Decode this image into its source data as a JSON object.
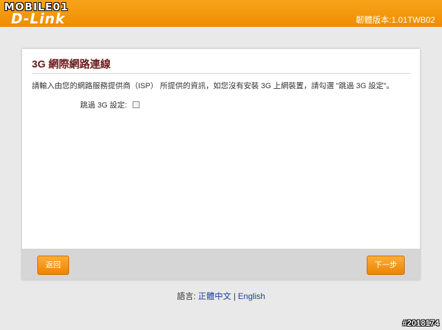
{
  "header": {
    "watermark_top": "MOBILE01",
    "logo_text": "D-Link",
    "firmware": "韌體版本:1.01TWB02"
  },
  "panel": {
    "title": "3G 網際網路連線",
    "description": "請輸入由您的網路服務提供商（ISP） 所提供的資訊，如您沒有安裝 3G 上網裝置，請勾選 \"跳過 3G 設定\"。",
    "skip_label": "跳過 3G 設定:",
    "skip_checked": false,
    "back_button": "返回",
    "next_button": "下一步"
  },
  "language": {
    "label": "語言:",
    "options": [
      "正體中文",
      "English"
    ],
    "separator": "|"
  },
  "watermark_bottom": "#2018174"
}
